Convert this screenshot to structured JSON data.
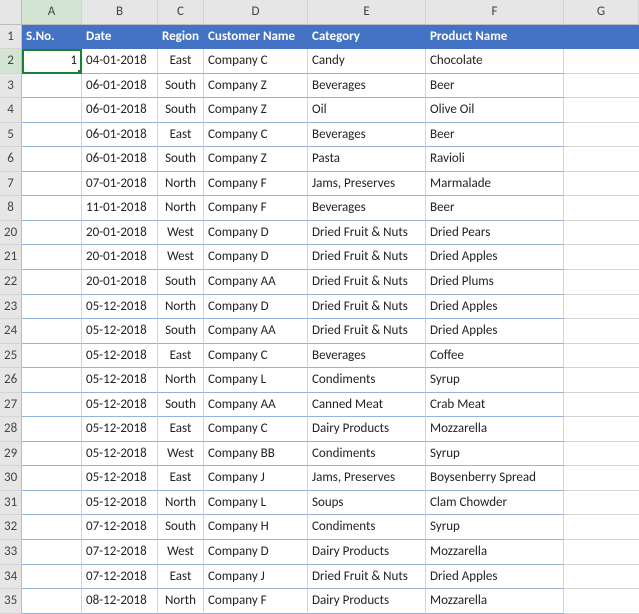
{
  "columns": [
    "A",
    "B",
    "C",
    "D",
    "E",
    "F",
    "G"
  ],
  "selected_col": "A",
  "selected_row": "2",
  "headers": {
    "sno": "S.No.",
    "date": "Date",
    "region": "Region",
    "customer": "Customer Name",
    "category": "Category",
    "product": "Product Name"
  },
  "rows": [
    {
      "rn": "1",
      "sno": "",
      "date": "",
      "region": "",
      "customer": "",
      "category": "",
      "product": "",
      "is_header": true
    },
    {
      "rn": "2",
      "sno": "1",
      "date": "04-01-2018",
      "region": "East",
      "customer": "Company C",
      "category": "Candy",
      "product": "Chocolate"
    },
    {
      "rn": "3",
      "sno": "",
      "date": "06-01-2018",
      "region": "South",
      "customer": "Company Z",
      "category": "Beverages",
      "product": "Beer"
    },
    {
      "rn": "4",
      "sno": "",
      "date": "06-01-2018",
      "region": "South",
      "customer": "Company Z",
      "category": "Oil",
      "product": "Olive Oil"
    },
    {
      "rn": "5",
      "sno": "",
      "date": "06-01-2018",
      "region": "East",
      "customer": "Company C",
      "category": "Beverages",
      "product": "Beer"
    },
    {
      "rn": "6",
      "sno": "",
      "date": "06-01-2018",
      "region": "South",
      "customer": "Company Z",
      "category": "Pasta",
      "product": "Ravioli"
    },
    {
      "rn": "7",
      "sno": "",
      "date": "07-01-2018",
      "region": "North",
      "customer": "Company F",
      "category": "Jams, Preserves",
      "product": "Marmalade"
    },
    {
      "rn": "8",
      "sno": "",
      "date": "11-01-2018",
      "region": "North",
      "customer": "Company F",
      "category": "Beverages",
      "product": "Beer"
    },
    {
      "rn": "20",
      "sno": "",
      "date": "20-01-2018",
      "region": "West",
      "customer": "Company D",
      "category": "Dried Fruit & Nuts",
      "product": "Dried Pears"
    },
    {
      "rn": "21",
      "sno": "",
      "date": "20-01-2018",
      "region": "West",
      "customer": "Company D",
      "category": "Dried Fruit & Nuts",
      "product": "Dried Apples"
    },
    {
      "rn": "22",
      "sno": "",
      "date": "20-01-2018",
      "region": "South",
      "customer": "Company AA",
      "category": "Dried Fruit & Nuts",
      "product": "Dried Plums"
    },
    {
      "rn": "23",
      "sno": "",
      "date": "05-12-2018",
      "region": "North",
      "customer": "Company D",
      "category": "Dried Fruit & Nuts",
      "product": "Dried Apples"
    },
    {
      "rn": "24",
      "sno": "",
      "date": "05-12-2018",
      "region": "South",
      "customer": "Company AA",
      "category": "Dried Fruit & Nuts",
      "product": "Dried Apples"
    },
    {
      "rn": "25",
      "sno": "",
      "date": "05-12-2018",
      "region": "East",
      "customer": "Company C",
      "category": "Beverages",
      "product": "Coffee"
    },
    {
      "rn": "26",
      "sno": "",
      "date": "05-12-2018",
      "region": "North",
      "customer": "Company L",
      "category": "Condiments",
      "product": "Syrup"
    },
    {
      "rn": "27",
      "sno": "",
      "date": "05-12-2018",
      "region": "South",
      "customer": "Company AA",
      "category": "Canned Meat",
      "product": "Crab Meat"
    },
    {
      "rn": "28",
      "sno": "",
      "date": "05-12-2018",
      "region": "East",
      "customer": "Company C",
      "category": "Dairy Products",
      "product": "Mozzarella"
    },
    {
      "rn": "29",
      "sno": "",
      "date": "05-12-2018",
      "region": "West",
      "customer": "Company BB",
      "category": "Condiments",
      "product": "Syrup"
    },
    {
      "rn": "30",
      "sno": "",
      "date": "05-12-2018",
      "region": "East",
      "customer": "Company J",
      "category": "Jams, Preserves",
      "product": "Boysenberry Spread"
    },
    {
      "rn": "31",
      "sno": "",
      "date": "05-12-2018",
      "region": "North",
      "customer": "Company L",
      "category": "Soups",
      "product": "Clam Chowder"
    },
    {
      "rn": "32",
      "sno": "",
      "date": "07-12-2018",
      "region": "South",
      "customer": "Company H",
      "category": "Condiments",
      "product": "Syrup"
    },
    {
      "rn": "33",
      "sno": "",
      "date": "07-12-2018",
      "region": "West",
      "customer": "Company D",
      "category": "Dairy Products",
      "product": "Mozzarella"
    },
    {
      "rn": "34",
      "sno": "",
      "date": "07-12-2018",
      "region": "East",
      "customer": "Company J",
      "category": "Dried Fruit & Nuts",
      "product": "Dried Apples"
    },
    {
      "rn": "35",
      "sno": "",
      "date": "08-12-2018",
      "region": "North",
      "customer": "Company F",
      "category": "Dairy Products",
      "product": "Mozzarella"
    }
  ]
}
